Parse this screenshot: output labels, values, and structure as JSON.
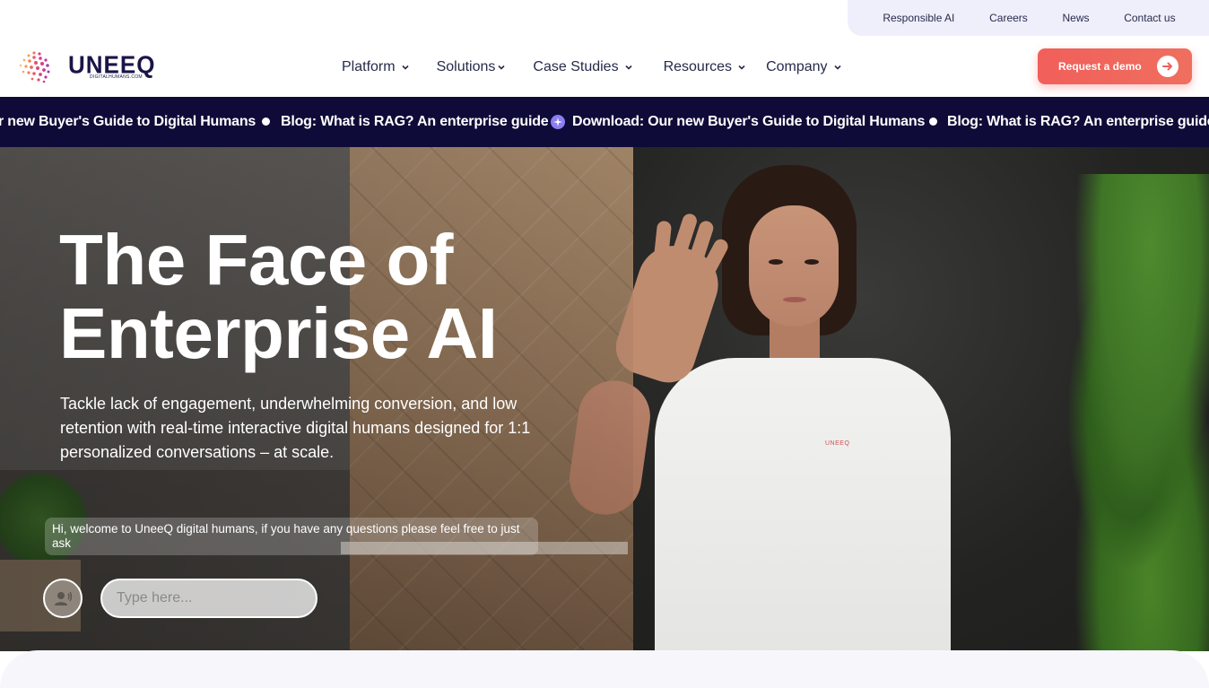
{
  "utility_nav": {
    "items": [
      "Responsible AI",
      "Careers",
      "News",
      "Contact us"
    ]
  },
  "brand": {
    "name": "UNEEQ",
    "subtitle": "DIGITALHUMANS.COM",
    "colors": {
      "navy": "#1a1547",
      "accent": "#f15f5a",
      "pink": "#e0407a"
    }
  },
  "main_nav": {
    "items": [
      {
        "label": "Platform",
        "icon": "chevron-down-icon"
      },
      {
        "label": "Solutions",
        "icon": "chevron-down-icon"
      },
      {
        "label": "Case Studies",
        "icon": "chevron-down-icon"
      },
      {
        "label": "Resources",
        "icon": "chevron-down-icon"
      },
      {
        "label": "Company",
        "icon": "chevron-down-icon"
      }
    ]
  },
  "cta": {
    "label": "Request a demo",
    "icon": "arrow-right-icon"
  },
  "ticker": {
    "items": [
      "r new Buyer's Guide to Digital Humans",
      "Blog: What is RAG? An enterprise guide",
      "Download: Our new Buyer's Guide to Digital Humans",
      "Blog: What is RAG? An enterprise guide"
    ],
    "background": "#0f0b38"
  },
  "hero": {
    "title_line1": "The Face of",
    "title_line2": "Enterprise AI",
    "subtitle": "Tackle lack of engagement, underwhelming conversion, and low retention with real-time interactive digital humans designed for 1:1 personalized conversations – at scale.",
    "shirt_logo": "UNEEQ"
  },
  "chat": {
    "welcome": "Hi, welcome to UneeQ digital humans, if you have any questions please feel free to just ask",
    "placeholder": "Type here...",
    "mic_icon": "microphone-icon"
  }
}
